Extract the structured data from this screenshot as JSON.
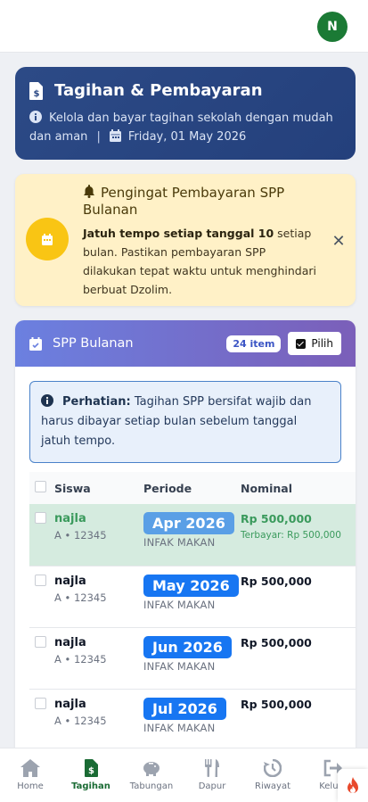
{
  "user": {
    "initial": "N"
  },
  "hero": {
    "title": "Tagihan & Pembayaran",
    "subtitle": "Kelola dan bayar tagihan sekolah dengan mudah dan aman",
    "date": "Friday, 01 May 2026"
  },
  "reminder": {
    "title": "Pengingat Pembayaran SPP Bulanan",
    "bold": "Jatuh tempo setiap tanggal 10",
    "text": " setiap bulan. Pastikan pembayaran SPP dilakukan tepat waktu untuk menghindari berbuat Dzolim."
  },
  "spp": {
    "title": "SPP Bulanan",
    "count_label": "24 item",
    "select_label": "Pilih",
    "info_bold": "Perhatian:",
    "info_text": " Tagihan SPP bersifat wajib dan harus dibayar setiap bulan sebelum tanggal jatuh tempo.",
    "columns": {
      "student": "Siswa",
      "period": "Periode",
      "amount": "Nominal"
    },
    "rows": [
      {
        "name": "najla",
        "class": "A • 12345",
        "period": "Apr 2026",
        "type": "INFAK MAKAN",
        "amount": "Rp 500,000",
        "note": "Terbayar: Rp 500,000",
        "paid": true
      },
      {
        "name": "najla",
        "class": "A • 12345",
        "period": "May 2026",
        "type": "INFAK MAKAN",
        "amount": "Rp 500,000",
        "note": "",
        "paid": false
      },
      {
        "name": "najla",
        "class": "A • 12345",
        "period": "Jun 2026",
        "type": "INFAK MAKAN",
        "amount": "Rp 500,000",
        "note": "",
        "paid": false
      },
      {
        "name": "najla",
        "class": "A • 12345",
        "period": "Jul 2026",
        "type": "INFAK MAKAN",
        "amount": "Rp 500,000",
        "note": "",
        "paid": false
      }
    ]
  },
  "nav": {
    "home": "Home",
    "bills": "Tagihan",
    "savings": "Tabungan",
    "kitchen": "Dapur",
    "history": "Riwayat",
    "logout": "Keluar"
  },
  "colors": {
    "primary": "#2c4a86",
    "accent_green": "#1b7a35",
    "badge_blue": "#1776f2",
    "reminder_bg": "#fff1c7"
  }
}
